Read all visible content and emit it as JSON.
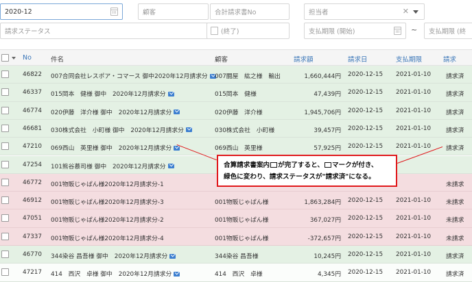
{
  "filters": {
    "month_value": "2020-12",
    "customer_placeholder": "顧客",
    "invoice_no_placeholder": "合計請求書No",
    "assignee_placeholder": "担当者",
    "status_placeholder": "請求ステータス",
    "end_placeholder": "(終了)",
    "due_start_placeholder": "支払期限 (開始)",
    "range_sep": "~",
    "due_end_placeholder": "支払期限 (終"
  },
  "table": {
    "headers": {
      "no": "No",
      "title": "件名",
      "customer": "顧客",
      "amount": "請求額",
      "date": "請求日",
      "due": "支払期限",
      "status": "請求"
    },
    "rows": [
      {
        "no": "46822",
        "title": "007合同会社レスポア・コマース 御中2020年12月請求分",
        "mail": true,
        "customer": "007闘屋　紘之様　輸出",
        "amount": "1,660,444円",
        "date": "2020-12-15",
        "due": "2021-01-10",
        "status": "請求済",
        "state": "green"
      },
      {
        "no": "46337",
        "title": "015岡本　健様 御中　2020年12月請求分",
        "mail": true,
        "customer": "015岡本　健様",
        "amount": "47,439円",
        "date": "2020-12-15",
        "due": "2021-01-10",
        "status": "請求済",
        "state": "green"
      },
      {
        "no": "46774",
        "title": "020伊藤　洋介様 御中　2020年12月請求分",
        "mail": true,
        "customer": "020伊藤　洋介様",
        "amount": "1,945,706円",
        "date": "2020-12-15",
        "due": "2021-01-10",
        "status": "請求済",
        "state": "green"
      },
      {
        "no": "46681",
        "title": "030株式会社　小町様 御中　2020年12月請求分",
        "mail": true,
        "customer": "030株式会社　小町様",
        "amount": "39,457円",
        "date": "2020-12-15",
        "due": "2021-01-10",
        "status": "請求済",
        "state": "green"
      },
      {
        "no": "47210",
        "title": "069西山　英里様 御中　2020年12月請求分",
        "mail": true,
        "customer": "069西山　英里様",
        "amount": "57,925円",
        "date": "2020-12-15",
        "due": "2021-01-10",
        "status": "請求済",
        "state": "green"
      },
      {
        "no": "47254",
        "title": "101熊谷慕司様 御中　2020年12月請求分",
        "mail": true,
        "customer": "",
        "amount": "",
        "date": "",
        "due": "",
        "status": "",
        "state": "green"
      },
      {
        "no": "46772",
        "title": "001物販じゃぱん様2020年12月請求分-1",
        "mail": false,
        "customer": "",
        "amount": "",
        "date": "",
        "due": "",
        "status": "未請求",
        "state": "red"
      },
      {
        "no": "46912",
        "title": "001物販じゃぱん様2020年12月請求分-3",
        "mail": false,
        "customer": "001物販じゃぱん様",
        "amount": "1,863,284円",
        "date": "2020-12-15",
        "due": "2021-01-10",
        "status": "未請求",
        "state": "red"
      },
      {
        "no": "47051",
        "title": "001物販じゃぱん様2020年12月請求分-2",
        "mail": false,
        "customer": "001物販じゃぱん様",
        "amount": "367,027円",
        "date": "2020-12-15",
        "due": "2021-01-10",
        "status": "未請求",
        "state": "red"
      },
      {
        "no": "47337",
        "title": "001物販じゃぱん様2020年12月請求分-4",
        "mail": false,
        "customer": "001物販じゃぱん様",
        "amount": "-372,657円",
        "date": "2020-12-15",
        "due": "2021-01-10",
        "status": "未請求",
        "state": "red"
      },
      {
        "no": "46770",
        "title": "344染谷 昌吾様 御中　2020年12月請求分",
        "mail": true,
        "customer": "344染谷 昌吾様",
        "amount": "10,245円",
        "date": "2020-12-15",
        "due": "2021-01-10",
        "status": "請求済",
        "state": "green"
      },
      {
        "no": "47217",
        "title": "414　西沢　卓様 御中　2020年12月請求分",
        "mail": true,
        "customer": "414　西沢　卓様",
        "amount": "4,345円",
        "date": "2020-12-15",
        "due": "2021-01-10",
        "status": "請求済",
        "state": "white"
      }
    ]
  },
  "callout": {
    "line1_a": "合算請求書案内",
    "line1_b": "が完了すると、",
    "line1_c": "マークが付き、",
    "line2": "緑色に変わり、請求ステータスが\"請求済\"になる。"
  },
  "colors": {
    "sent_row": "#e4f1e4",
    "unsent_row": "#f4dde0",
    "header_link": "#3a76b8",
    "annotation": "#e0181b"
  }
}
